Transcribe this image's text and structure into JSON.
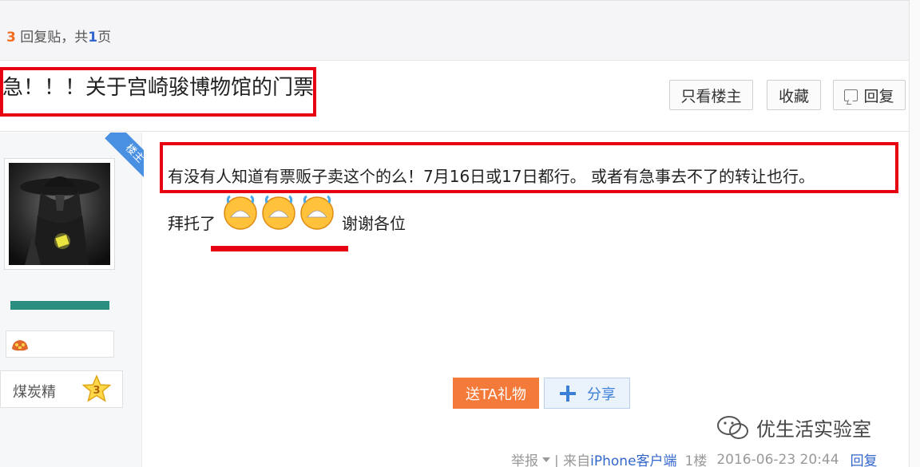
{
  "header": {
    "reply_count": "3",
    "reply_label": "回复贴，共",
    "page_count": "1",
    "page_label": "页"
  },
  "thread": {
    "title": "急！！！关于宫崎骏博物馆的门票",
    "buttons": {
      "only_host": "只看楼主",
      "favorite": "收藏",
      "reply": "回复"
    }
  },
  "author": {
    "badge": "楼主",
    "avatar_icon": "avatar-dark-hat-figure",
    "pet_icon": "pet-icon",
    "rank_title": "煤炭精",
    "rank_level": "3"
  },
  "post": {
    "line1": "有没有人知道有票贩子卖这个的么！7月16日或17日都行。 或者有急事去不了的转让也行。",
    "line2_prefix": "拜托了",
    "emoji_icons": [
      "crying-face-icon",
      "crying-face-icon",
      "crying-face-icon"
    ],
    "line2_suffix": "谢谢各位"
  },
  "actions": {
    "gift": "送TA礼物",
    "share": "分享"
  },
  "watermark": {
    "text": "优生活实验室"
  },
  "meta": {
    "report": "举报",
    "separator": "| 来自",
    "source": "iPhone客户端",
    "floor": "1楼",
    "date": "2016-06-23 20:44",
    "reply": "回复"
  },
  "colors": {
    "highlight_red": "#e60012",
    "accent_orange": "#f47a3a",
    "link_blue": "#3366cc",
    "badge_blue": "#4a90e2"
  }
}
